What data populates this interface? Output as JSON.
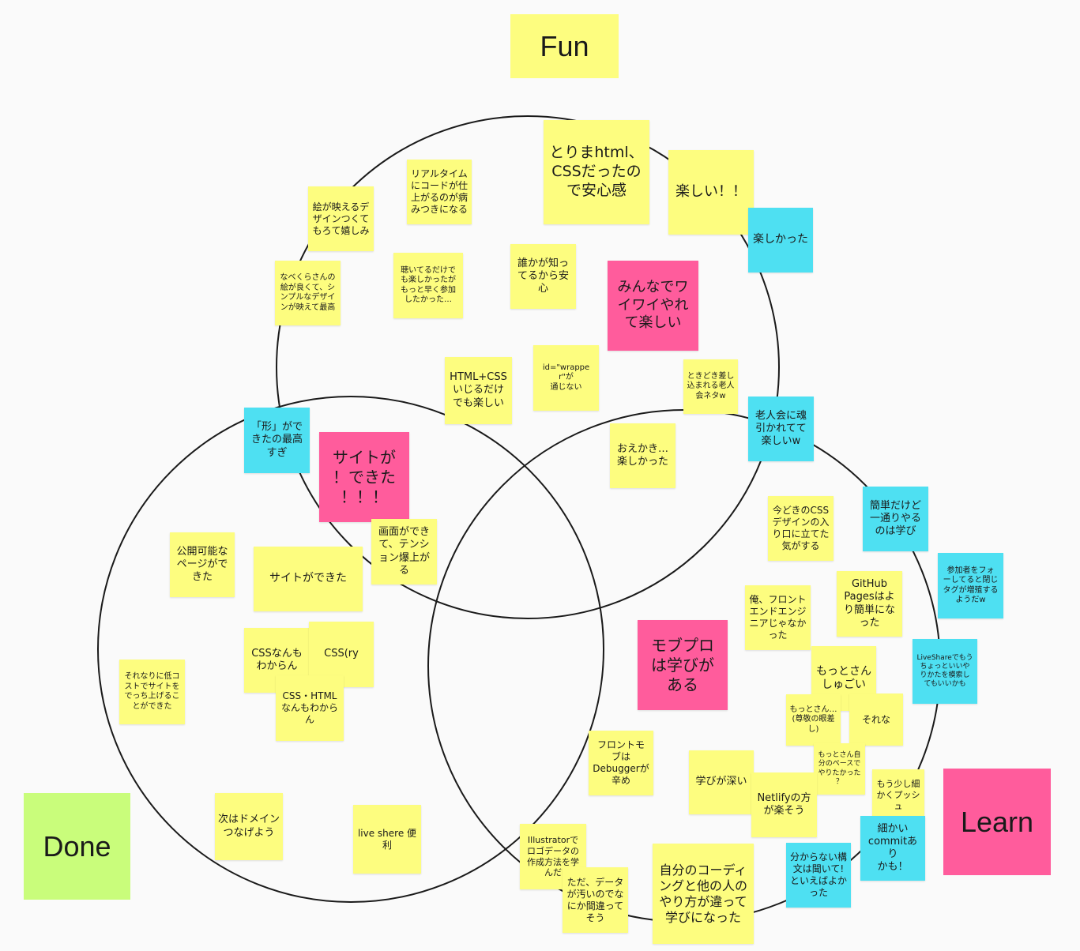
{
  "colors": {
    "yellow": "#fdfd7f",
    "pink": "#ff5c9c",
    "cyan": "#4ee0f2",
    "green": "#c9fd7b",
    "circle_stroke": "#1a1a1a"
  },
  "labels": {
    "fun": "Fun",
    "done": "Done",
    "learn": "Learn"
  },
  "notes": {
    "torima": "とりまhtml、\nCSSだったの\nで安心感",
    "tanoshii1": "楽しい！！",
    "tanoshikatta": "楽しかった",
    "realtime": "リアルタイム\nにコードが仕\n上がるのが病\nみつきになる",
    "e_ga_haeru": "絵が映えるデ\nザインつくて\nもろて嬉しみ",
    "nabekura": "なべくらさんの\n絵が良くて、シ\nンプルなデザイ\nンが映えて最高",
    "kiiteru": "聴いてるだけで\nも楽しかったが\nもっと早く参加\nしたかった…",
    "dareka": "誰かが知っ\nてるから安\n心",
    "minnade": "みんなでワ\nイワイやれ\nて楽しい",
    "wrapper": "id=\"wrapper\"が\n通じない",
    "htmlcss_ijiru": "HTML+CSS\nいじるだけ\nでも楽しい",
    "tokidoki": "ときどき差し\n込まれる老人\n会ネタw",
    "rojinkai": "老人会に魂\n引かれてて\n楽しいw",
    "katachi": "「形」がで\nきたの最高\nすぎ",
    "site_dekita_pink": "サイトが\n！できた\n！！！",
    "oekaki": "おえかき…\n楽しかった",
    "imadoki": "今どきのCSS\nデザインの入\nり口に立てた\n気がする",
    "kantan_dakedo": "簡単だけど\n一通りやる\nのは学び",
    "sankasha": "参加者をフォ\nーしてると閉じ\nタグが増殖する\nようだw",
    "gamen_dekite": "画面ができ\nて、テンシ\nョン爆上が\nる",
    "koukai_kanou": "公開可能な\nページがで\nきた",
    "site_dekita": "サイトができた",
    "github_pages": "GitHub\nPagesはよ\nり簡単にな\nった",
    "ore_front": "俺、フロント\nエンドエンジ\nニアじゃなか\nった",
    "mobpro": "モブプロ\nは学びが\nある",
    "liveshare_mou": "LiveShareでもう\nちょっといいや\nりかたを模索し\nてもいいかも",
    "css_nanmo": "CSSなんも\nわからん",
    "css_ry": "CSS(ry",
    "motto_shugoi": "もっとさん\nしゅごい",
    "css_html_nanmo": "CSS・HTML\nなんもわから\nん",
    "soreni_teicost": "それなりに低コ\nストでサイトを\nでっち上げるこ\nとができた",
    "motto_sonkei": "もっとさん…\n(尊敬の眼差\nし)",
    "sorena": "それな",
    "front_mob": "フロントモ\nブは\nDebuggerが\n辛め",
    "motto_jibun": "もっとさん自\n分のペースで\nやりたかった\n？",
    "manabi_fukai": "学びが深い",
    "mou_sukoshi": "もう少し細\nかくプッシ\nュ",
    "netlify": "Netlifyの方\nが楽そう",
    "tsugi_domain": "次はドメイン\nつなげよう",
    "liveshere": "live shere 便\n利",
    "illustrator": "Illustratorで\nロゴデータの\n作成方法を学\nんだ",
    "komakai_commit": "細かい\ncommitあり\nかも！",
    "wakaranai_koubun": "分からない構\n文は聞いて!\nといえばよか\nった",
    "tada_data": "ただ、データ\nが汚いのでな\nにか間違って\nそう",
    "jibun_coding": "自分のコーディ\nングと他の人の\nやり方が違って\n学びになった"
  }
}
